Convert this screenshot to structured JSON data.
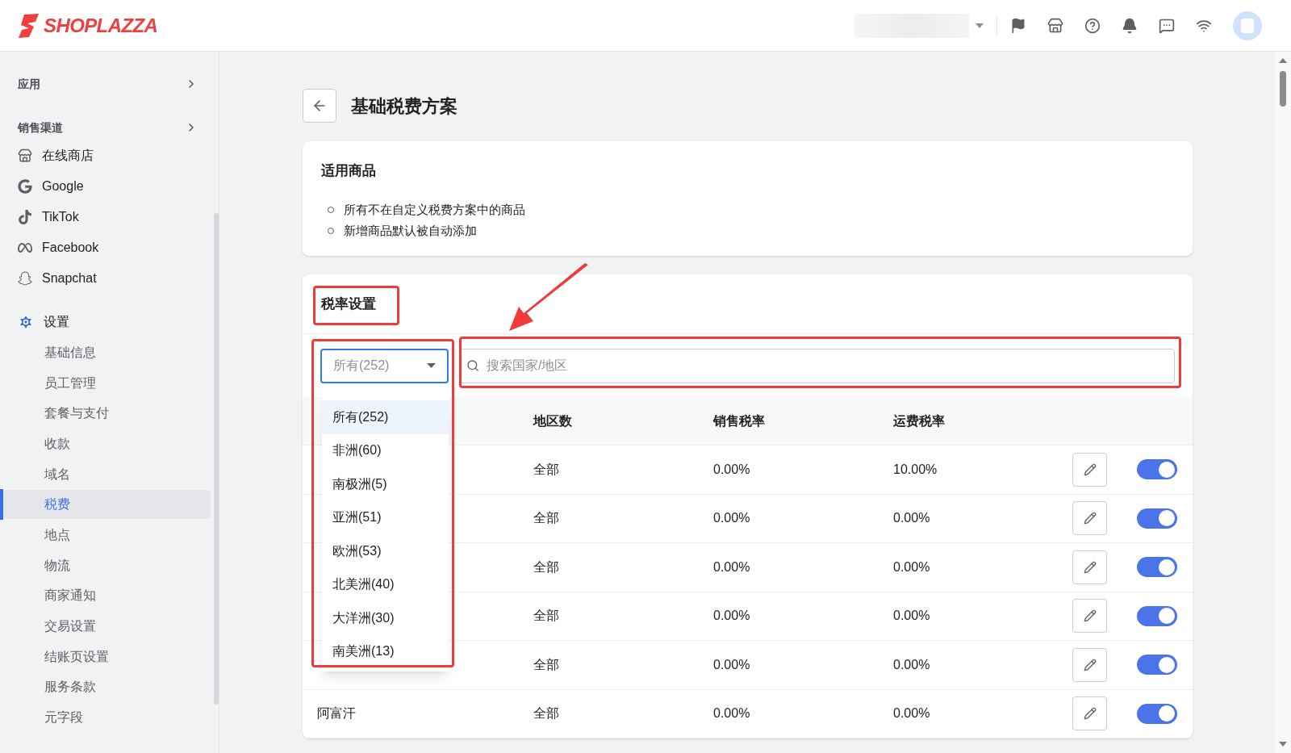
{
  "header": {
    "logo": "SHOPLAZZA"
  },
  "sidebar": {
    "apps_label": "应用",
    "channels_label": "销售渠道",
    "channels": [
      {
        "label": "在线商店"
      },
      {
        "label": "Google"
      },
      {
        "label": "TikTok"
      },
      {
        "label": "Facebook"
      },
      {
        "label": "Snapchat"
      }
    ],
    "settings": {
      "label": "设置",
      "items": [
        {
          "label": "基础信息",
          "selected": false
        },
        {
          "label": "员工管理",
          "selected": false
        },
        {
          "label": "套餐与支付",
          "selected": false
        },
        {
          "label": "收款",
          "selected": false
        },
        {
          "label": "域名",
          "selected": false
        },
        {
          "label": "税费",
          "selected": true
        },
        {
          "label": "地点",
          "selected": false
        },
        {
          "label": "物流",
          "selected": false
        },
        {
          "label": "商家通知",
          "selected": false
        },
        {
          "label": "交易设置",
          "selected": false
        },
        {
          "label": "结账页设置",
          "selected": false
        },
        {
          "label": "服务条款",
          "selected": false
        },
        {
          "label": "元字段",
          "selected": false
        }
      ]
    }
  },
  "page": {
    "title": "基础税费方案"
  },
  "products_card": {
    "title": "适用商品",
    "bullets": [
      "所有不在自定义税费方案中的商品",
      "新增商品默认被自动添加"
    ]
  },
  "rates_card": {
    "title": "税率设置",
    "filter": {
      "value": "所有(252)",
      "expanded": true,
      "options": [
        {
          "label": "所有(252)",
          "selected": true
        },
        {
          "label": "非洲(60)",
          "selected": false
        },
        {
          "label": "南极洲(5)",
          "selected": false
        },
        {
          "label": "亚洲(51)",
          "selected": false
        },
        {
          "label": "欧洲(53)",
          "selected": false
        },
        {
          "label": "北美洲(40)",
          "selected": false
        },
        {
          "label": "大洋洲(30)",
          "selected": false
        },
        {
          "label": "南美洲(13)",
          "selected": false
        }
      ]
    },
    "search": {
      "placeholder": "搜索国家/地区"
    },
    "columns": [
      "地区数",
      "销售税率",
      "运费税率"
    ],
    "rows": [
      {
        "regions": "全部",
        "sales_rate": "0.00%",
        "shipping_rate": "10.00%",
        "on": true
      },
      {
        "regions": "全部",
        "sales_rate": "0.00%",
        "shipping_rate": "0.00%",
        "on": true
      },
      {
        "regions": "全部",
        "sales_rate": "0.00%",
        "shipping_rate": "0.00%",
        "on": true
      },
      {
        "regions": "全部",
        "sales_rate": "0.00%",
        "shipping_rate": "0.00%",
        "on": true
      },
      {
        "regions": "全部",
        "sales_rate": "0.00%",
        "shipping_rate": "0.00%",
        "on": true
      },
      {
        "name": "阿富汗",
        "regions": "全部",
        "sales_rate": "0.00%",
        "shipping_rate": "0.00%",
        "on": true
      }
    ]
  }
}
